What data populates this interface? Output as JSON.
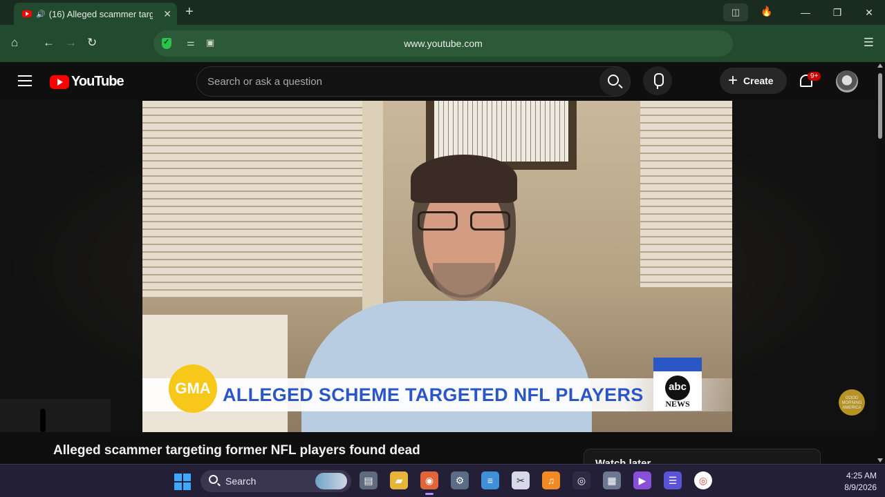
{
  "browser": {
    "tab_title": "(16) Alleged scammer targ",
    "tab_close": "✕",
    "new_tab": "+",
    "url": "www.youtube.com",
    "window_controls": [
      "—",
      "❐",
      "✕"
    ]
  },
  "youtube": {
    "logo_text": "YouTube",
    "search_placeholder": "Search or ask a question",
    "create_label": "Create",
    "notification_badge": "9+",
    "brand_color": "#ff0000"
  },
  "video": {
    "lower_third": "ALLEGED SCHEME TARGETED NFL PLAYERS",
    "gma_badge": "GMA",
    "abc_logo": "abc",
    "abc_news": "NEWS",
    "watermark": "GOOD MORNING AMERICA",
    "title": "Alleged scammer targeting former NFL players found dead"
  },
  "panel": {
    "watch_later": "Watch later"
  },
  "taskbar": {
    "search_label": "Search",
    "time": "4:25 AM",
    "date": "8/9/2026"
  }
}
